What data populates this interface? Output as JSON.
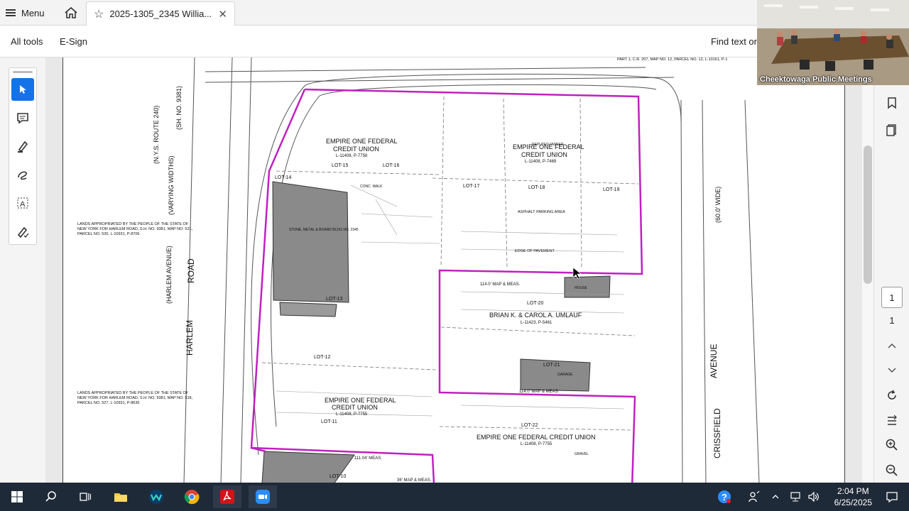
{
  "tabbar": {
    "menu_label": "Menu",
    "tab_title": "2025-1305_2345 Willia...",
    "close_glyph": "✕"
  },
  "toolbar": {
    "all_tools": "All tools",
    "esign": "E-Sign",
    "find_text": "Find text or"
  },
  "left_tools": [
    "select-cursor-icon",
    "comment-icon",
    "highlighter-icon",
    "draw-freehand-icon",
    "text-recognition-icon",
    "fill-sign-icon"
  ],
  "right_tools": [
    "bookmarks-icon",
    "page-thumbnails-icon"
  ],
  "pagination": {
    "current_page": "1",
    "total_pages": "1"
  },
  "video": {
    "label": "Cheektowaga Public Meetings"
  },
  "taskbar": {
    "time": "2:04 PM",
    "date": "6/25/2025"
  },
  "drawing": {
    "route_label": "(N.Y.S. ROUTE 240)",
    "sh_label": "(SH. NO. 9381)",
    "width_label": "(VARYING WIDTHS)",
    "road_label": "ROAD",
    "harlem_label": "HARLEM",
    "harlem_avenue": "(HARLEM AVENUE)",
    "crissfield": "CRISSFIELD",
    "avenue": "AVENUE",
    "width_60": "(60.0' WIDE)",
    "owner_1": "EMPIRE ONE FEDERAL",
    "owner_1b": "CREDIT UNION",
    "deed_1": "L-11408, P-7758",
    "owner_2": "EMPIRE ONE FEDERAL",
    "owner_2b": "CREDIT UNION",
    "deed_2": "L-11408, P-7469",
    "owner_3": "BRIAN K. & CAROL A. UMLAUF",
    "deed_3": "L-11423, P-5461",
    "owner_4": "EMPIRE ONE FEDERAL",
    "owner_4b": "CREDIT UNION",
    "deed_4": "L-11408, P-7755",
    "owner_5": "EMPIRE ONE FEDERAL CREDIT UNION",
    "deed_5": "L-11408, P-7755",
    "reputed_owner": "REPUTED OWNER",
    "lot_15": "LOT-15",
    "lot_16": "LOT-16",
    "lot_17": "LOT-17",
    "lot_18": "LOT-18",
    "lot_19": "LOT-19",
    "lot_14": "LOT-14",
    "lot_20": "LOT-20",
    "lot_21": "LOT-21",
    "lot_22": "LOT-22",
    "lot_12": "LOT-12",
    "lot_11": "LOT-11",
    "lot_10": "LOT-10",
    "lot_13": "LOT-13",
    "approp_1": "LANDS APPROPRIATED BY THE PEOPLE OF THE STATE OF NEW YORK FOR HARLEM ROAD, S.H. NO. 9381, MAP NO. 521, PARCEL NO. 530, L-10931, P-8706",
    "approp_2": "LANDS APPROPRIATED BY THE PEOPLE OF THE STATE OF NEW YORK FOR HARLEM ROAD, S.H. NO. 9381, MAP NO. 518, PARCEL NO. 527, L-10931, P-8635",
    "asphalt_parking": "ASPHALT PARKING AREA",
    "edge_pavement": "EDGE OF PAVEMENT",
    "stone_building": "STONE, METAL & BOARD BLDG NO. 2345",
    "conc_walk": "CONC. WALK",
    "meas_114": "114.0' MAP & MEAS.",
    "meas_111": "111.04' MEAS.",
    "meas_36": "36' MAP & MEAS.",
    "parcel_top": "PART 1, C.R. 207, MAP NO. 12, PARCEL NO. 12, L-10161, P-1",
    "garage": "GARAGE",
    "house": "HOUSE",
    "gravel": "GRAVEL"
  }
}
